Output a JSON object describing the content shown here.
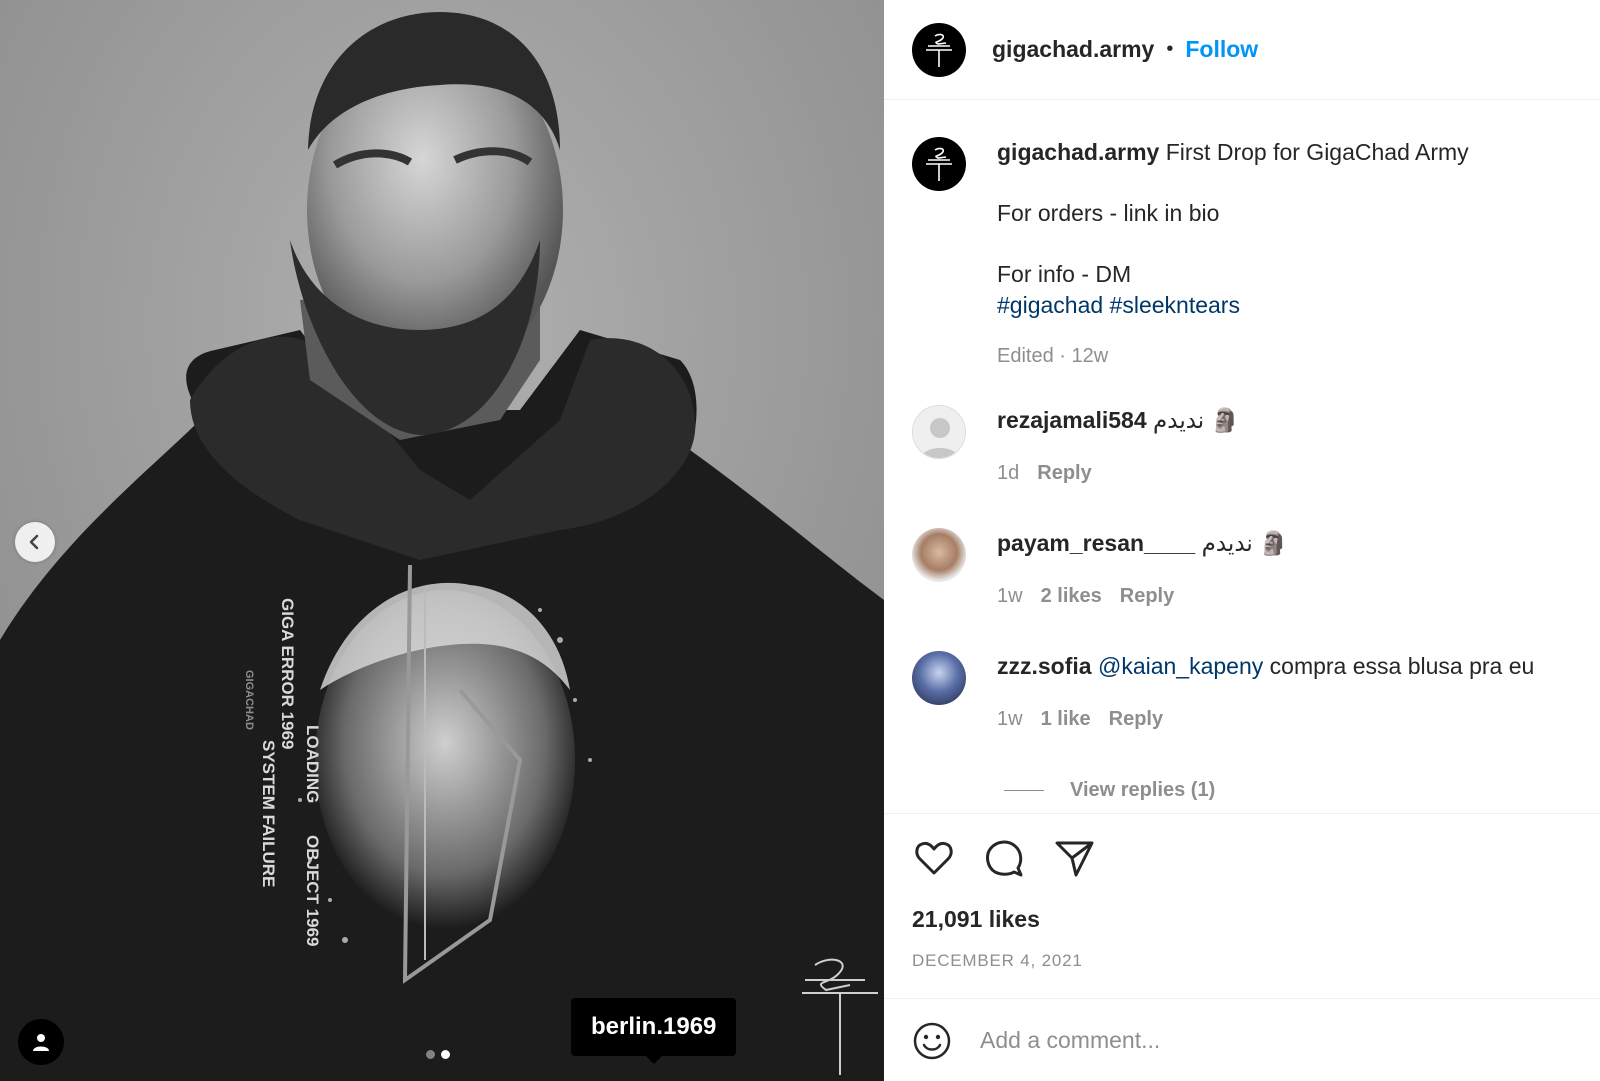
{
  "post": {
    "tag_label": "berlin.1969",
    "carousel": {
      "count": 2,
      "active": 2
    },
    "print_text": {
      "line1": "GIGA ERROR 1969",
      "line2": "SYSTEM FAILURE",
      "line3": "LOADING",
      "line4": "OBJECT 1969",
      "line5": "GIGACHAD"
    }
  },
  "header": {
    "username": "gigachad.army",
    "separator": "•",
    "follow_label": "Follow"
  },
  "caption": {
    "username": "gigachad.army",
    "text": "First Drop for GigaChad Army",
    "line2": "For orders - link in bio",
    "line3": "For info - DM",
    "hashtag1": "#gigachad",
    "hashtag2": "#sleekntears",
    "meta": "Edited · 12w"
  },
  "comments": [
    {
      "username": "rezajamali584",
      "text": "ندیدم 🗿",
      "time": "1d",
      "likes": "",
      "reply": "Reply"
    },
    {
      "username": "payam_resan____",
      "text": "ندیدم 🗿",
      "time": "1w",
      "likes": "2 likes",
      "reply": "Reply"
    },
    {
      "username": "zzz.sofia",
      "mention": "@kaian_kapeny",
      "text": "compra essa blusa pra eu",
      "time": "1w",
      "likes": "1 like",
      "reply": "Reply"
    }
  ],
  "view_replies": "View replies (1)",
  "stats": {
    "likes": "21,091 likes",
    "date": "DECEMBER 4, 2021"
  },
  "add_comment": {
    "placeholder": "Add a comment..."
  },
  "colors": {
    "accent": "#0095f6",
    "link": "#00376b",
    "muted": "#8e8e8e",
    "divider": "#efefef"
  }
}
